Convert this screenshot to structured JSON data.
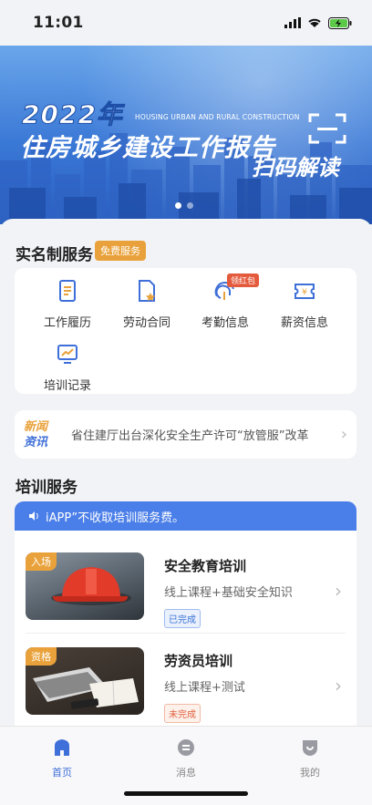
{
  "status": {
    "time": "11:01"
  },
  "banner": {
    "year": "2022年",
    "english": "HOUSING URBAN AND RURAL CONSTRUCTION",
    "title": "住房城乡建设工作报告",
    "scan": "扫码解读"
  },
  "realname": {
    "title": "实名制服务",
    "badge": "免费服务",
    "items": [
      {
        "label": "工作履历",
        "icon": "document-icon"
      },
      {
        "label": "劳动合同",
        "icon": "contract-icon"
      },
      {
        "label": "考勤信息",
        "icon": "fingerprint-icon",
        "tag": "领红包"
      },
      {
        "label": "薪资信息",
        "icon": "salary-icon"
      },
      {
        "label": "培训记录",
        "icon": "chart-screen-icon"
      }
    ]
  },
  "news": {
    "logo_top": "新闻",
    "logo_bottom": "资讯",
    "text": "省住建厅出台深化安全生产许可“放管服”改革"
  },
  "training": {
    "title": "培训服务",
    "notice": "iAPP”不收取培训服务费。",
    "courses": [
      {
        "tag": "入场",
        "title": "安全教育培训",
        "desc": "线上课程+基础安全知识",
        "status": "已完成"
      },
      {
        "tag": "资格",
        "title": "劳资员培训",
        "desc": "线上课程+测试",
        "status": "未完成"
      }
    ]
  },
  "tabbar": {
    "tabs": [
      {
        "label": "首页",
        "icon": "home-icon"
      },
      {
        "label": "消息",
        "icon": "message-icon"
      },
      {
        "label": "我的",
        "icon": "profile-icon"
      }
    ]
  },
  "colors": {
    "accent": "#3f6fd8",
    "badge": "#e9a23b",
    "red": "#e45a3c"
  }
}
